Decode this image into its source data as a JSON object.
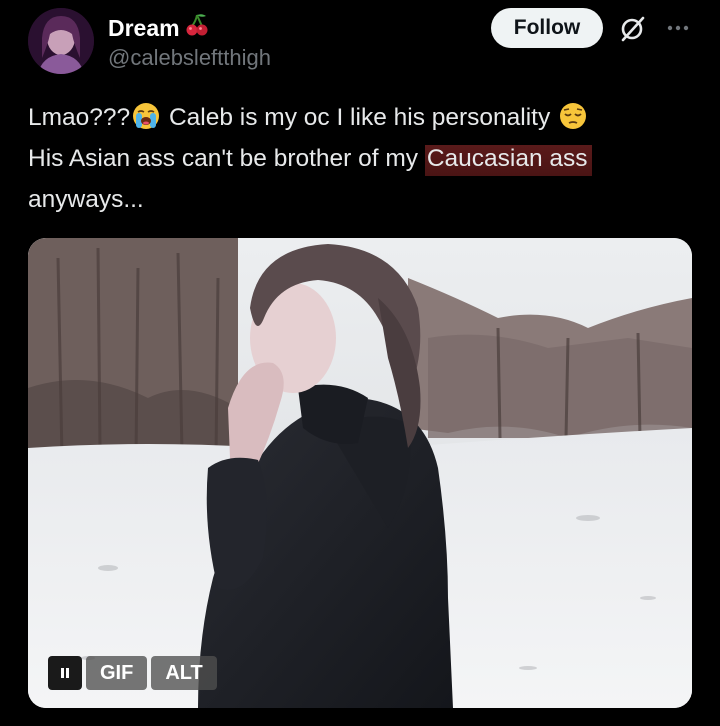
{
  "author": {
    "display_name": "Dream",
    "name_emoji": "cherries-icon",
    "handle": "@calebsleftthigh",
    "avatar": "avatar"
  },
  "actions": {
    "follow_label": "Follow",
    "grok_icon": "grok-icon",
    "more_icon": "more-icon"
  },
  "tweet": {
    "line1_a": "Lmao???",
    "line1_b": " Caleb is my oc I like his personality ",
    "line2_a": "His Asian ass can't be brother of my ",
    "line2_highlight": "Caucasian ass",
    "line3": "anyways...",
    "emojis": [
      "loudly-crying-face-icon",
      "pensive-face-icon"
    ]
  },
  "media": {
    "pause_icon": "pause-icon",
    "gif_label": "GIF",
    "alt_label": "ALT"
  },
  "colors": {
    "background": "#000000",
    "text": "#e7e9ea",
    "secondary": "#71767b",
    "follow_bg": "#eff3f4",
    "highlight": "#5a1a1a"
  }
}
